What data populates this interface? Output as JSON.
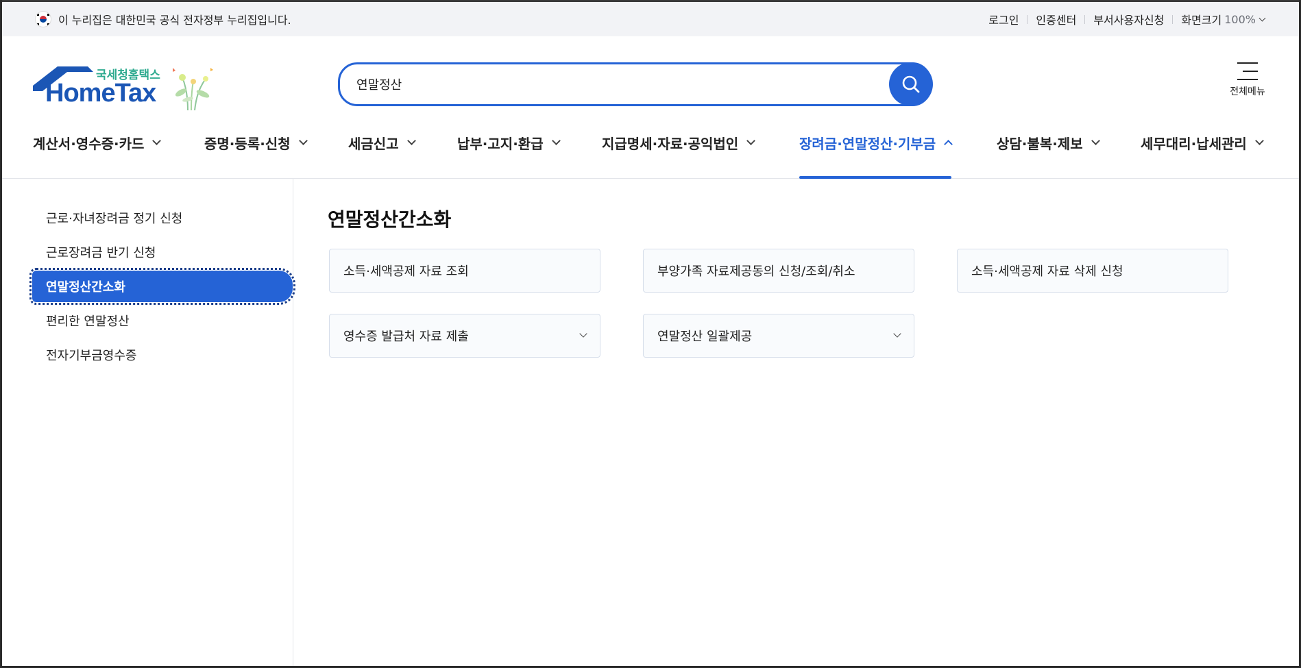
{
  "gov_banner": {
    "text": "이 누리집은 대한민국 공식 전자정부 누리집입니다.",
    "links": [
      "로그인",
      "인증센터",
      "부서사용자신청"
    ],
    "zoom_label": "화면크기",
    "zoom_value": "100%"
  },
  "logo": {
    "korean": "국세청홈택스",
    "english": "HomeTax"
  },
  "search": {
    "value": "연말정산"
  },
  "all_menu_label": "전체메뉴",
  "gnb": [
    {
      "label": "계산서·영수증·카드",
      "active": false
    },
    {
      "label": "증명·등록·신청",
      "active": false
    },
    {
      "label": "세금신고",
      "active": false
    },
    {
      "label": "납부·고지·환급",
      "active": false
    },
    {
      "label": "지급명세·자료·공익법인",
      "active": false
    },
    {
      "label": "장려금·연말정산·기부금",
      "active": true
    },
    {
      "label": "상담·불복·제보",
      "active": false
    },
    {
      "label": "세무대리·납세관리",
      "active": false
    }
  ],
  "lnb": [
    {
      "label": "근로·자녀장려금 정기 신청"
    },
    {
      "label": "근로장려금 반기 신청"
    },
    {
      "label": "연말정산간소화",
      "active": true
    },
    {
      "label": "편리한 연말정산"
    },
    {
      "label": "전자기부금영수증"
    }
  ],
  "main": {
    "title": "연말정산간소화",
    "cards": [
      {
        "label": "소득·세액공제 자료 조회",
        "expandable": false
      },
      {
        "label": "부양가족 자료제공동의 신청/조회/취소",
        "expandable": false
      },
      {
        "label": "소득·세액공제 자료 삭제 신청",
        "expandable": false
      },
      {
        "label": "영수증 발급처 자료 제출",
        "expandable": true
      },
      {
        "label": "연말정산 일괄제공",
        "expandable": true
      }
    ]
  },
  "colors": {
    "primary": "#2563d6",
    "logo_blue": "#1b56b5",
    "logo_green": "#2eaa8f"
  }
}
